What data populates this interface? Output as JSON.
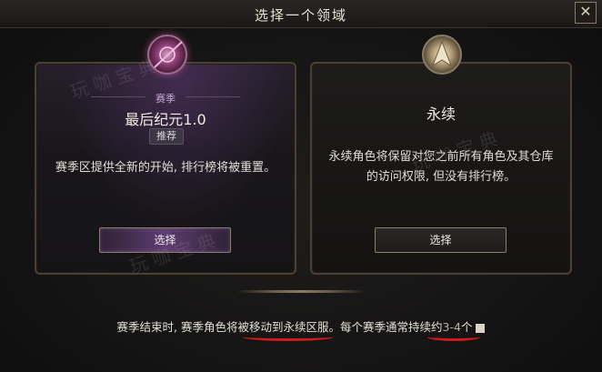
{
  "window": {
    "title": "选择一个领域",
    "close_glyph": "✕"
  },
  "seasonal": {
    "tag": "赛季",
    "name": "最后纪元1.0",
    "badge": "推荐",
    "description": "赛季区提供全新的开始, 排行榜将被重置。",
    "button": "选择",
    "icon": "seasonal-crest-icon"
  },
  "eternal": {
    "name": "永续",
    "description": "永续角色将保留对您之前所有角色及其仓库的访问权限, 但没有排行榜。",
    "button": "选择",
    "icon": "eternal-crest-icon"
  },
  "footer": {
    "part1": "赛季结束时, 赛季角色将",
    "part2": "被移动到永续区服",
    "part3": "。每个赛季通常持续",
    "part4": "约",
    "range": "3-4",
    "part5": "个"
  },
  "watermark": "玩咖宝典",
  "colors": {
    "seasonal_accent": "#5e3f72",
    "border": "#4a4034",
    "annotation_red": "#d11a1a"
  }
}
